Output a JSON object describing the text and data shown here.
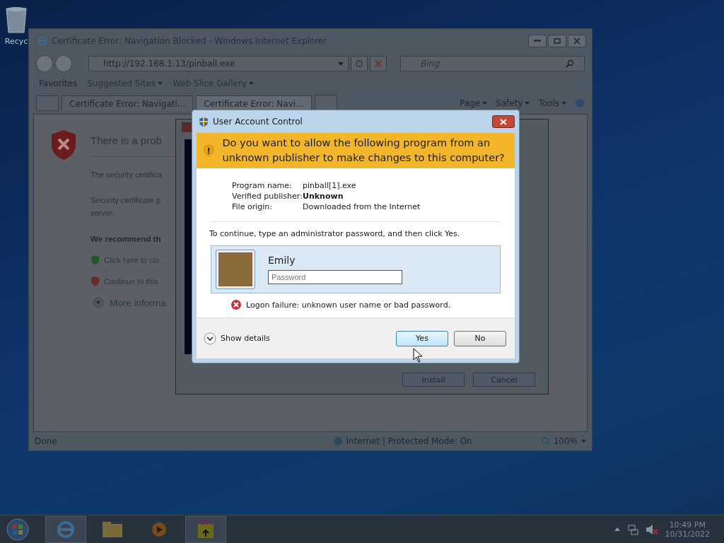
{
  "desktop": {
    "icons": [
      {
        "label": "Recyc"
      }
    ]
  },
  "browser": {
    "title": "Certificate Error: Navigation Blocked - Windows Internet Explorer",
    "address": "http://192.168.1.13/pinball.exe",
    "search_placeholder": "Bing",
    "favorites": {
      "label": "Favorites",
      "links": [
        "Suggested Sites",
        "Web Slice Gallery"
      ]
    },
    "tabs": [
      {
        "label": "Certificate Error: Navigati...",
        "selected": false
      },
      {
        "label": "Certificate Error: Navi...",
        "selected": true
      }
    ],
    "commands": [
      "Page",
      "Safety",
      "Tools"
    ],
    "page": {
      "heading": "There is a prob",
      "lines": [
        "The security certifica",
        "Security certificate p",
        "server."
      ],
      "recommend": "We recommend th",
      "options": [
        {
          "kind": "safe",
          "label": "Click here to clo"
        },
        {
          "kind": "risk",
          "label": "Continue to this"
        }
      ],
      "more": "More informa"
    },
    "status": {
      "text": "Done",
      "zone": "Internet | Protected Mode: On",
      "zoom": "100%"
    }
  },
  "installer": {
    "buttons": [
      "Install",
      "Cancel"
    ]
  },
  "uac": {
    "title": "User Account Control",
    "question": "Do you want to allow the following program from an unknown publisher to make changes to this computer?",
    "details": [
      {
        "label": "Program name:",
        "value": "pinball[1].exe",
        "strong": false
      },
      {
        "label": "Verified publisher:",
        "value": "Unknown",
        "strong": true
      },
      {
        "label": "File origin:",
        "value": "Downloaded from the Internet",
        "strong": false
      }
    ],
    "instruction": "To continue, type an administrator password, and then click Yes.",
    "user": "Emily",
    "password_placeholder": "Password",
    "error": "Logon failure: unknown user name or bad password.",
    "show_details": "Show details",
    "buttons": [
      {
        "label": "Yes",
        "default": true
      },
      {
        "label": "No",
        "default": false
      }
    ]
  },
  "taskbar": {
    "time": "10:49 PM",
    "date": "10/31/2022"
  }
}
